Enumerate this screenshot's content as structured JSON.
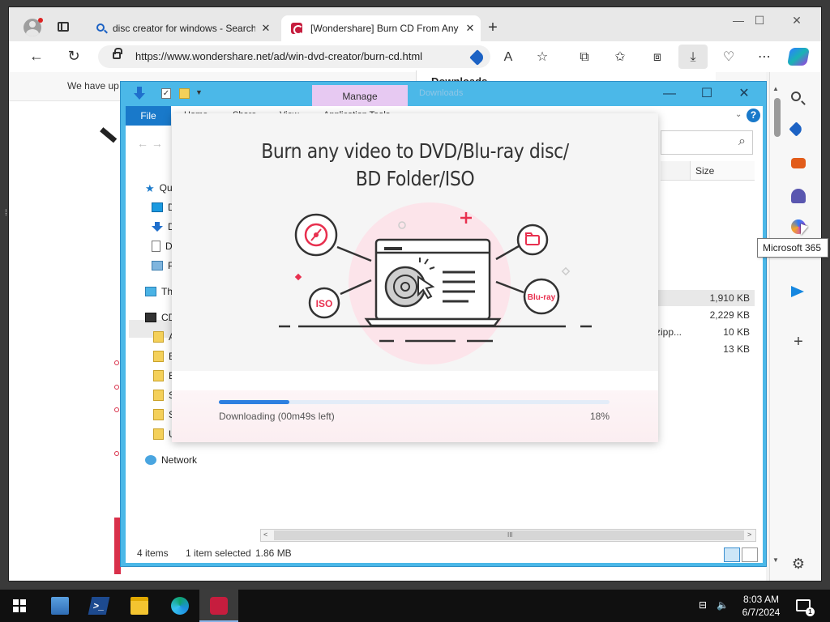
{
  "browser": {
    "tabs": [
      {
        "title": "disc creator for windows - Search",
        "close": "✕"
      },
      {
        "title": "[Wondershare] Burn CD From Any",
        "close": "✕"
      }
    ],
    "new_tab": "+",
    "window_controls": {
      "minimize": "—",
      "maximize": "☐",
      "close": "✕"
    },
    "url": "https://www.wondershare.net/ad/win-dvd-creator/burn-cd.html",
    "toolbar_glyphs": {
      "back": "←",
      "refresh": "↻",
      "read_aloud": "A",
      "favorite": "☆",
      "split": "⧉",
      "favorites": "✩",
      "collections": "⧈",
      "download": "⤓",
      "more": "⋯"
    },
    "page_strip_text": "We have up",
    "downloads_title": "Downloads",
    "sidebar_glyphs": {
      "add": "+",
      "settings": "⚙"
    },
    "tooltip": "Microsoft 365"
  },
  "explorer": {
    "manage_tab": "Manage",
    "ghost_title": "Downloads",
    "controls": {
      "minimize": "—",
      "maximize": "☐",
      "close": "✕"
    },
    "ribbon": {
      "file": "File",
      "tabs": [
        "Home",
        "Share",
        "View",
        "Application Tools"
      ],
      "help": "?"
    },
    "nav_arrows": "←  →",
    "column_size": "Size",
    "sizes": [
      "1,910 KB",
      "2,229 KB",
      "10 KB",
      "13 KB"
    ],
    "name_fragment": "zipp...",
    "tree": [
      {
        "icon": "star",
        "label": "Qu"
      },
      {
        "icon": "desk",
        "label": "D"
      },
      {
        "icon": "down",
        "label": "D"
      },
      {
        "icon": "doc",
        "label": "D"
      },
      {
        "icon": "pic",
        "label": "P"
      },
      {
        "icon": "pc",
        "label": "Th"
      },
      {
        "icon": "cd",
        "label": "CD"
      },
      {
        "icon": "folder",
        "label": "A"
      },
      {
        "icon": "folder",
        "label": "B"
      },
      {
        "icon": "folder",
        "label": "E"
      },
      {
        "icon": "folder",
        "label": "S"
      },
      {
        "icon": "folder",
        "label": "S"
      },
      {
        "icon": "folder",
        "label": "U"
      },
      {
        "icon": "net",
        "label": "Network"
      }
    ],
    "status": {
      "items": "4 items",
      "selected": "1 item selected",
      "size": "1.86 MB"
    },
    "scroll_glyphs": {
      "left": "<",
      "right": ">",
      "grip": "III"
    }
  },
  "installer": {
    "title_line1": "Burn any video to DVD/Blu-ray disc/",
    "title_line2": "BD Folder/ISO",
    "badges": {
      "iso": "ISO",
      "bluray": "Blu-ray"
    },
    "progress_text": "Downloading (00m49s left)",
    "progress_percent_label": "18%",
    "progress_percent": 18
  },
  "taskbar": {
    "clock_time": "8:03 AM",
    "clock_date": "6/7/2024",
    "ps_glyph": ">_",
    "tray_glyphs": {
      "network": "⊟",
      "volume": "🔈"
    },
    "notif_count": "1"
  },
  "colors": {
    "accent": "#2d7fe0",
    "brand_red": "#e8304f",
    "explorer_frame": "#4bb8e8"
  }
}
